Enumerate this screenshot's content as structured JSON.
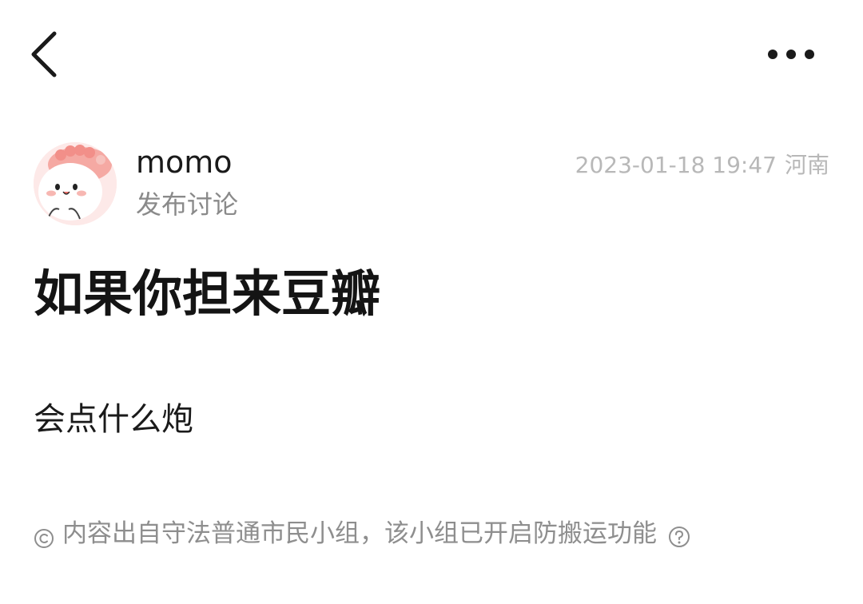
{
  "topbar": {
    "back_icon": "chevron-left-icon",
    "more_icon": "more-horizontal-icon"
  },
  "author": {
    "name": "momo",
    "action": "发布讨论",
    "avatar_icon": "cartoon-avatar"
  },
  "meta": {
    "datetime": "2023-01-18 19:47",
    "location": "河南"
  },
  "post": {
    "title": "如果你担来豆瓣",
    "body": "会点什么炮"
  },
  "footer": {
    "copyright_icon": "copyright-icon",
    "notice": "内容出自守法普通市民小组，该小组已开启防搬运功能",
    "help_icon": "question-circle-icon"
  },
  "colors": {
    "text_primary": "#1a1a1a",
    "text_secondary": "#8a8a8a",
    "text_meta": "#b8b8b8",
    "background": "#ffffff",
    "avatar_bg": "#fde9e8"
  }
}
